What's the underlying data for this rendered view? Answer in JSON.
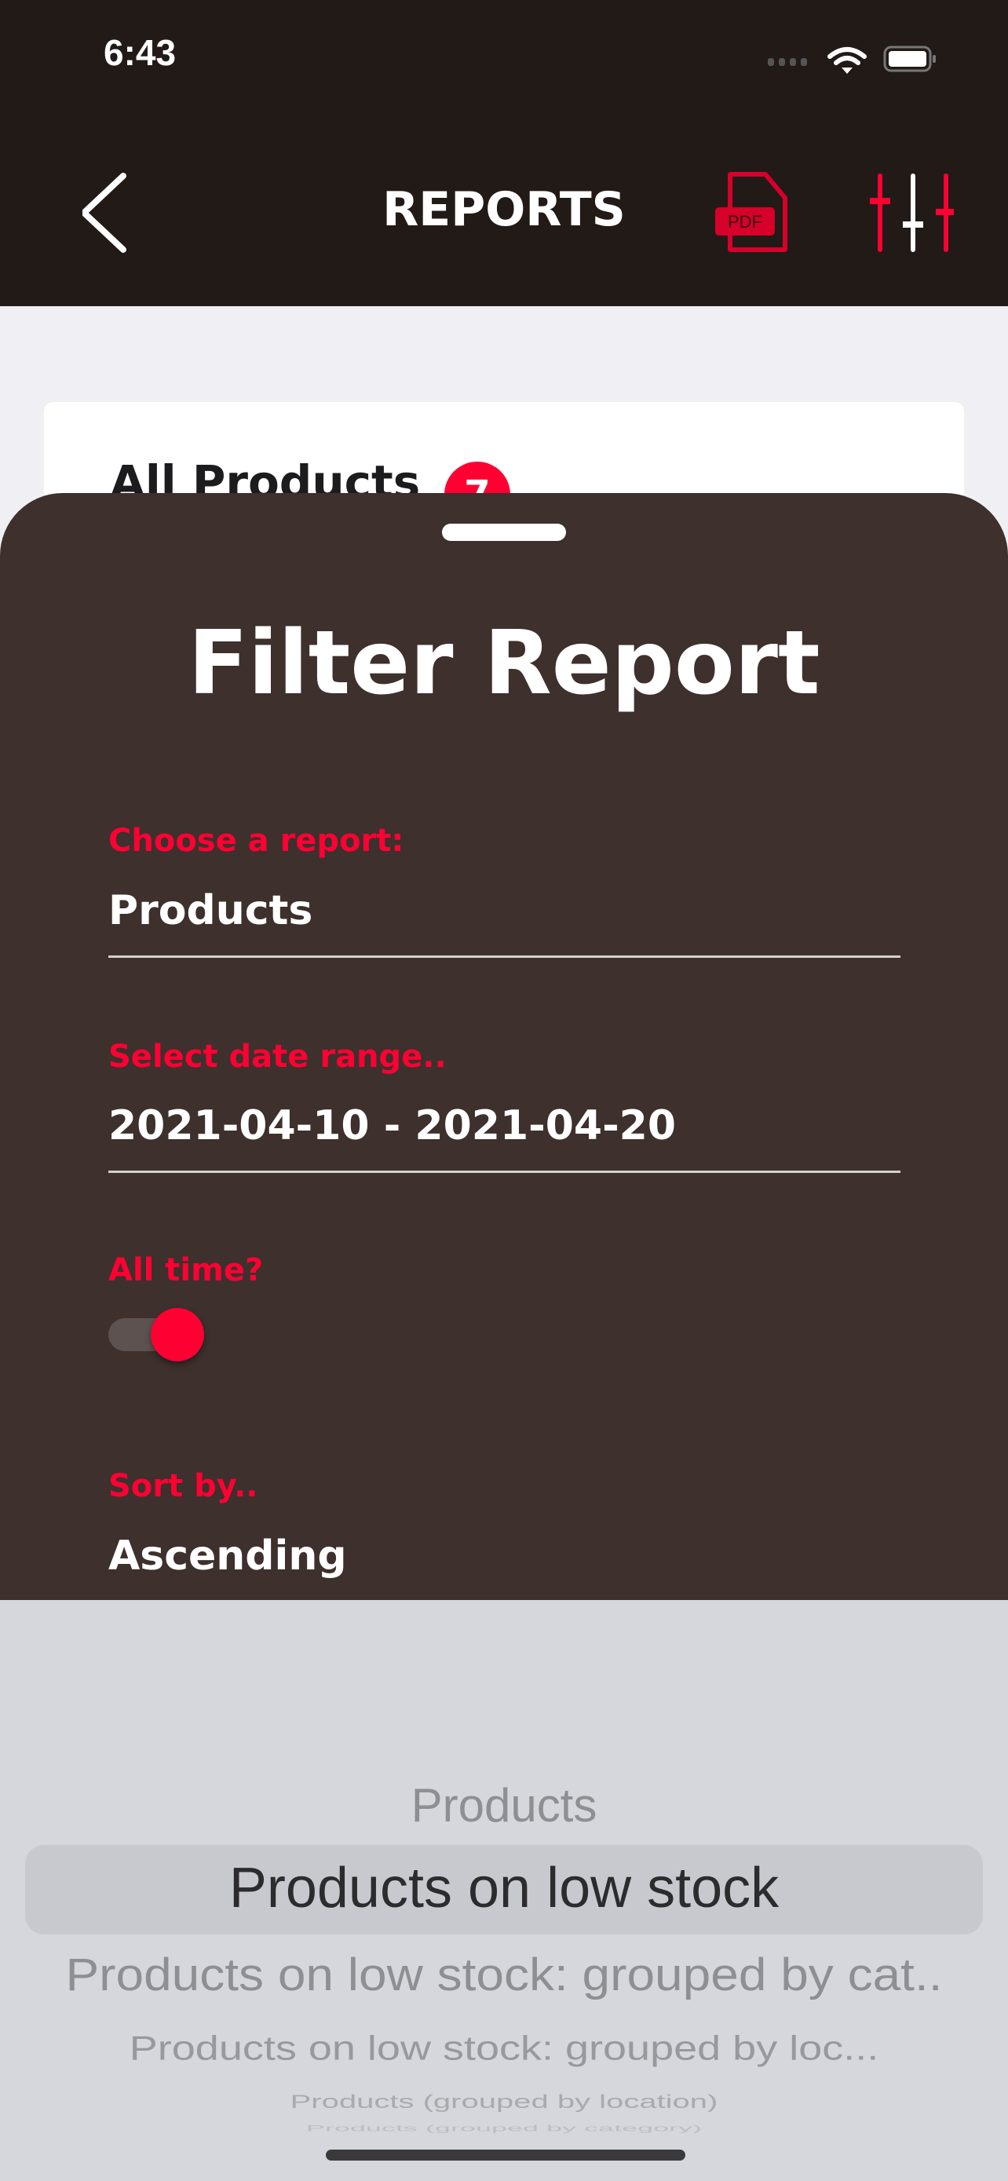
{
  "status_bar": {
    "time": "6:43"
  },
  "header": {
    "title": "REPORTS",
    "pdf_icon_label": "PDF",
    "accent": "#ff0033"
  },
  "card": {
    "title": "All Products",
    "badge": "7"
  },
  "sheet": {
    "title": "Filter Report",
    "report_label": "Choose a report:",
    "report_value": "Products",
    "date_label": "Select date range..",
    "date_value": "2021-04-10 - 2021-04-20",
    "alltime_label": "All time?",
    "alltime_on": true,
    "sort_label": "Sort by..",
    "sort_value": "Ascending"
  },
  "picker": {
    "items": [
      "Products",
      "Products on low stock",
      "Products on low stock: grouped by cat..",
      "Products on low stock: grouped by loc...",
      "Products (grouped by location)",
      "Products (grouped by category)"
    ],
    "selected": "Products on low stock"
  }
}
